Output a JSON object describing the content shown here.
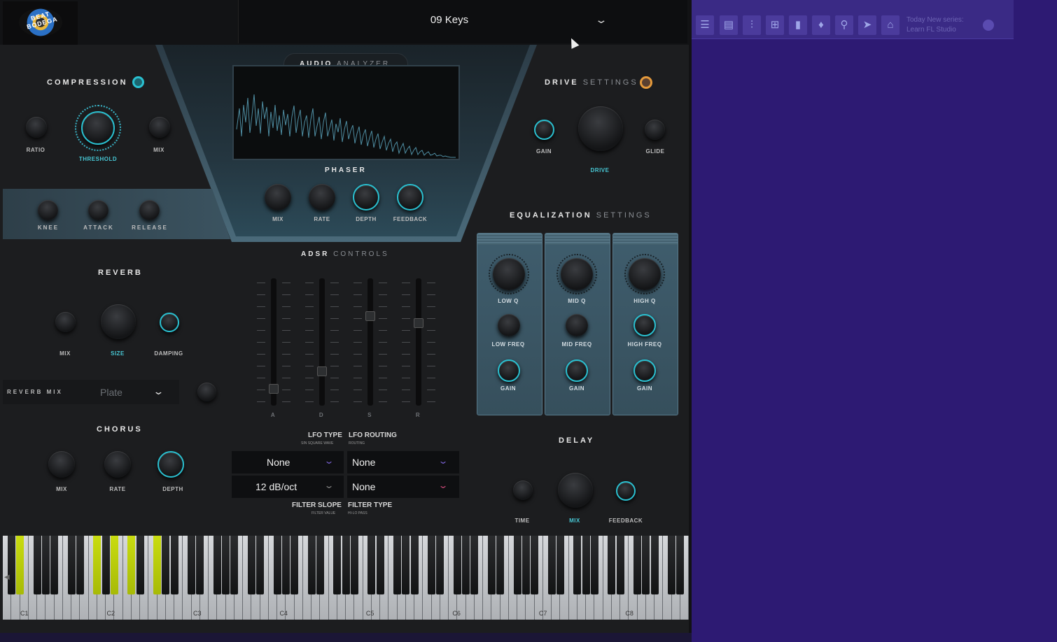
{
  "plugin": {
    "logo_text": "BEAT BODEGA",
    "preset_name": "09 Keys",
    "compression": {
      "title": "COMPRESSION",
      "knobs": [
        "RATIO",
        "THRESHOLD",
        "MIX"
      ],
      "dynamics": [
        "KNEE",
        "ATTACK",
        "RELEASE"
      ]
    },
    "audio_analyzer": {
      "title_a": "AUDIO",
      "title_b": "ANALYZER"
    },
    "phaser": {
      "title": "PHASER",
      "knobs": [
        "MIX",
        "RATE",
        "DEPTH",
        "FEEDBACK"
      ]
    },
    "drive": {
      "title_a": "DRIVE",
      "title_b": "SETTINGS",
      "knobs": [
        "GAIN",
        "DRIVE",
        "GLIDE"
      ]
    },
    "equalization": {
      "title_a": "EQUALIZATION",
      "title_b": "SETTINGS",
      "columns": [
        {
          "q": "LOW Q",
          "freq": "LOW FREQ",
          "gain": "GAIN"
        },
        {
          "q": "MID Q",
          "freq": "MID FREQ",
          "gain": "GAIN"
        },
        {
          "q": "HIGH Q",
          "freq": "HIGH FREQ",
          "gain": "GAIN"
        }
      ]
    },
    "reverb": {
      "title": "REVERB",
      "knobs": [
        "MIX",
        "SIZE",
        "DAMPING"
      ],
      "reverb_mix_label": "REVERB MIX",
      "type_value": "Plate"
    },
    "adsr": {
      "title_a": "ADSR",
      "title_b": "CONTROLS",
      "faders": [
        "A",
        "D",
        "S",
        "R"
      ],
      "levels": [
        0.1,
        0.25,
        0.72,
        0.66
      ]
    },
    "chorus": {
      "title": "CHORUS",
      "knobs": [
        "MIX",
        "RATE",
        "DEPTH"
      ]
    },
    "lfo": {
      "type_label": "LFO TYPE",
      "type_sub": "SIN SQUARE WAVE",
      "routing_label": "LFO ROUTING",
      "routing_sub": "ROUTING",
      "type_value": "None",
      "routing_value": "None",
      "slope_value": "12 dB/oct",
      "filter_type_value": "None",
      "slope_label": "FILTER SLOPE",
      "slope_sub": "FILTER VALUE",
      "filter_type_label": "FILTER TYPE",
      "filter_type_sub": "HI-LO PASS"
    },
    "delay": {
      "title": "DELAY",
      "knobs": [
        "TIME",
        "MIX",
        "FEEDBACK"
      ]
    },
    "keyboard": {
      "octave_labels": [
        "C1",
        "C2",
        "C3",
        "C4",
        "C5",
        "C6",
        "C7",
        "C8"
      ],
      "highlighted_black_keys": [
        1,
        7,
        9,
        10,
        12
      ]
    },
    "colors": {
      "accent_cyan": "#2ac0d0",
      "drive_orange": "#e59a3c",
      "key_highlight": "#c9dc10"
    }
  },
  "host": {
    "news_line1": "Today New series:",
    "news_line2": "Learn FL Studio",
    "toolbar_icons": [
      "playlist-icon",
      "piano-roll-icon",
      "mixer-icon",
      "channel-rack-icon",
      "browser-icon",
      "plugin-icon",
      "tempo-icon",
      "share-icon",
      "shop-icon"
    ]
  }
}
